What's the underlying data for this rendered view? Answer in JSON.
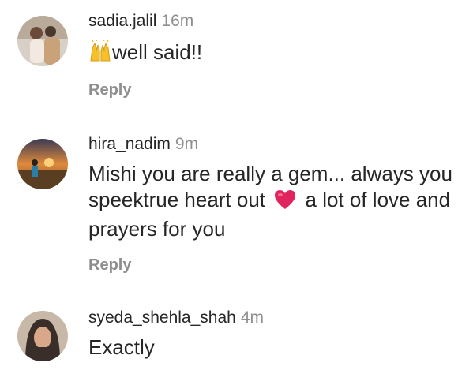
{
  "comments": [
    {
      "username": "sadia.jalil",
      "time": "16m",
      "text_before": "",
      "emoji": "raising-hands",
      "text_after": "well said!!",
      "reply_label": "Reply"
    },
    {
      "username": "hira_nadim",
      "time": "9m",
      "line1": "Mishi you are really a gem... always you",
      "line2_before": "speektrue heart out",
      "emoji": "red-heart",
      "line2_after": "a lot of love and",
      "line3": "prayers for you",
      "reply_label": "Reply"
    },
    {
      "username": "syeda_shehla_shah",
      "time": "4m",
      "text": "Exactly"
    }
  ],
  "colors": {
    "primary_text": "#262626",
    "secondary_text": "#8e8e8e",
    "heart": "#e0245e",
    "hands": "#f6c02b"
  }
}
